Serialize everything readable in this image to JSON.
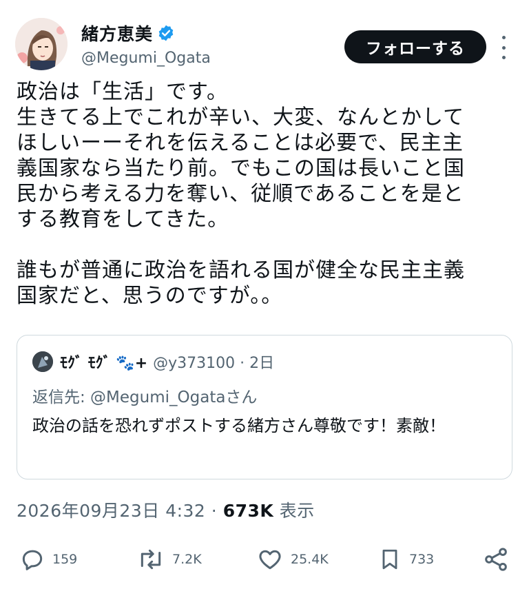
{
  "author": {
    "name": "緒方恵美",
    "handle": "@Megumi_Ogata"
  },
  "follow_label": "フォローする",
  "post_text": "政治は「生活」です。\n生きてる上でこれが辛い、大変、なんとかして\nほしいーーそれを伝えることは必要で、民主主\n義国家なら当たり前。でもこの国は長いこと国\n民から考える力を奪い、従順であることを是と\nする教育をしてきた。\n\n誰もが普通に政治を語れる国が健全な民主主義\n国家だと、思うのですが。。",
  "quote": {
    "name": "ﾓｸﾞ ﾓｸﾞ 🐾+",
    "handle_time": "@y373100 · 2日",
    "reply_to": "返信先: @Megumi_Ogataさん",
    "text": "政治の話を恐れずポストする緒方さん尊敬です！素敵！"
  },
  "timestamp": {
    "date": "2026年09月23日 4:32 · ",
    "views": "673K",
    "views_label": " 表示"
  },
  "actions": {
    "replies": "159",
    "reposts": "7.2K",
    "likes": "25.4K",
    "bookmarks": "733"
  },
  "colors": {
    "text": "#0f1419",
    "secondary": "#536471",
    "verified": "#1d9bf0",
    "border": "#cfd9de"
  }
}
